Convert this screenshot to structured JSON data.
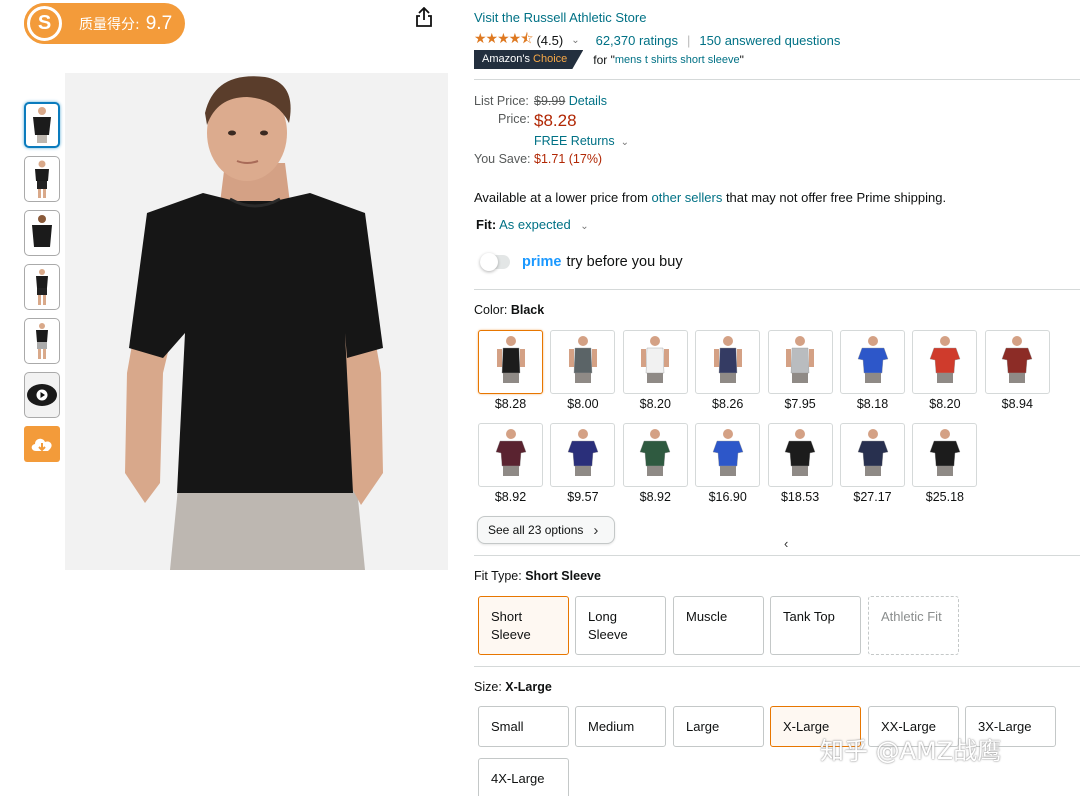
{
  "quality_badge": {
    "icon_letter": "S",
    "label": "质量得分:",
    "score": "9.7"
  },
  "store": {
    "link": "Visit the Russell Athletic Store"
  },
  "rating": {
    "stars": "★★★★⯪",
    "value": "(4.5)",
    "count": "62,370 ratings",
    "answered": "150 answered questions"
  },
  "badge": {
    "prefix": "Amazon's",
    "suffix": "Choice",
    "for_text": "for \"",
    "keyword": "mens t shirts short sleeve",
    "close_quote": "\""
  },
  "price": {
    "list_label": "List Price:",
    "list_value": "$9.99",
    "details": "Details",
    "price_label": "Price:",
    "price_value": "$8.28",
    "returns": "FREE Returns",
    "save_label": "You Save:",
    "save_value": "$1.71 (17%)"
  },
  "availability": {
    "before": "Available at a lower price from ",
    "link": "other sellers",
    "after": " that may not offer free Prime shipping."
  },
  "fit": {
    "label": "Fit:",
    "value": "As expected"
  },
  "prime": {
    "word": "prime",
    "text": "try before you buy"
  },
  "color": {
    "label": "Color:",
    "selected": "Black",
    "swatches": [
      {
        "price": "$8.28",
        "color": "#1c1c1c"
      },
      {
        "price": "$8.00",
        "color": "#5b6467"
      },
      {
        "price": "$8.20",
        "color": "#f1f1f1"
      },
      {
        "price": "$8.26",
        "color": "#343b63"
      },
      {
        "price": "$7.95",
        "color": "#b9bcbf"
      },
      {
        "price": "$8.18",
        "color": "#2d57c9"
      },
      {
        "price": "$8.20",
        "color": "#cf3b2c"
      },
      {
        "price": "$8.94",
        "color": "#8c2c26"
      },
      {
        "price": "$8.92",
        "color": "#5a2330"
      },
      {
        "price": "$9.57",
        "color": "#2a2f7a"
      },
      {
        "price": "$8.92",
        "color": "#2f5a40"
      },
      {
        "price": "$16.90",
        "color": "#2d57c9"
      },
      {
        "price": "$18.53",
        "color": "#1c1c1c"
      },
      {
        "price": "$27.17",
        "color": "#28304f"
      },
      {
        "price": "$25.18",
        "color": "#1c1c1c"
      }
    ],
    "see_all": "See all 23 options"
  },
  "fit_type": {
    "label": "Fit Type:",
    "selected": "Short Sleeve",
    "options": [
      {
        "line1": "Short",
        "line2": "Sleeve"
      },
      {
        "line1": "Long",
        "line2": "Sleeve"
      },
      {
        "line1": "Muscle",
        "line2": ""
      },
      {
        "line1": "Tank Top",
        "line2": ""
      },
      {
        "line1": "Athletic Fit",
        "line2": ""
      }
    ]
  },
  "size": {
    "label": "Size:",
    "selected": "X-Large",
    "options": [
      "Small",
      "Medium",
      "Large",
      "X-Large",
      "XX-Large",
      "3X-Large",
      "4X-Large"
    ]
  },
  "watermark": "知乎 @AMZ战鹰",
  "colors": {
    "orange": "#f39b3a",
    "link": "#007185",
    "price_red": "#b12704",
    "selected_border": "#e77600"
  }
}
